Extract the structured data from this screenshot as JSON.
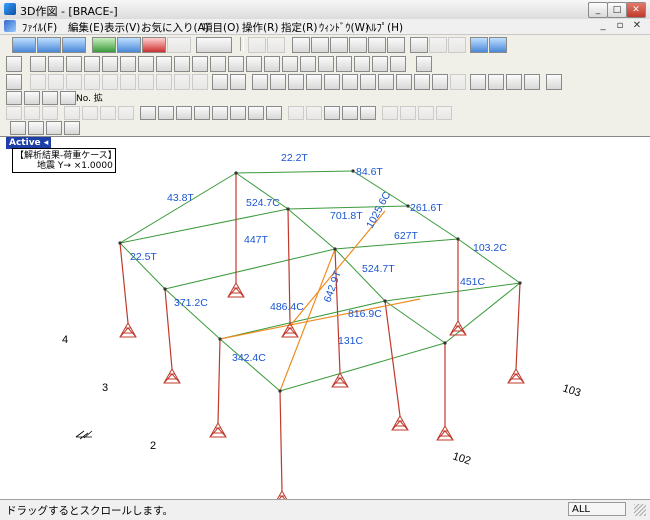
{
  "window": {
    "title": "3D作図 - [BRACE-]",
    "min": "_",
    "max": "□",
    "close": "✕"
  },
  "menu": [
    {
      "label": "ﾌｧｲﾙ(F)"
    },
    {
      "label": "編集(E)"
    },
    {
      "label": "表示(V)"
    },
    {
      "label": "お気に入り(A)"
    },
    {
      "label": "項目(O)"
    },
    {
      "label": "操作(R)"
    },
    {
      "label": "指定(R)"
    },
    {
      "label": "ｳｨﾝﾄﾞｳ(W)"
    },
    {
      "label": "ﾍﾙﾌﾟ(H)"
    }
  ],
  "mdi": {
    "min": "_",
    "restore": "▫",
    "close": "✕"
  },
  "toolbars": {
    "row4_label": "No. 拡",
    "row4_no": "No."
  },
  "canvas": {
    "active": "Active ◂",
    "result_title": "【解析結果-荷重ケース】",
    "result_case": "地震 Y→ ×1.0000"
  },
  "chart_data": {
    "axis_labels": [
      "4",
      "3",
      "2",
      "102",
      "103"
    ],
    "member_forces": [
      {
        "label": "22.2T"
      },
      {
        "label": "84.6T"
      },
      {
        "label": "43.8T"
      },
      {
        "label": "524.7C"
      },
      {
        "label": "701.8T"
      },
      {
        "label": "1025.6C"
      },
      {
        "label": "261.6T"
      },
      {
        "label": "447T"
      },
      {
        "label": "627T"
      },
      {
        "label": "103.2C"
      },
      {
        "label": "22.5T"
      },
      {
        "label": "524.7T"
      },
      {
        "label": "642.9T"
      },
      {
        "label": "451C"
      },
      {
        "label": "371.2C"
      },
      {
        "label": "486.4C"
      },
      {
        "label": "816.9C"
      },
      {
        "label": "131C"
      },
      {
        "label": "342.4C"
      }
    ]
  },
  "status": {
    "message": "ドラッグするとスクロールします。",
    "indicator": "ALL"
  },
  "colors": {
    "frame": "#3a9a3a",
    "column": "#c0392b",
    "brace": "#f08c20",
    "label": "#1a55d0"
  }
}
